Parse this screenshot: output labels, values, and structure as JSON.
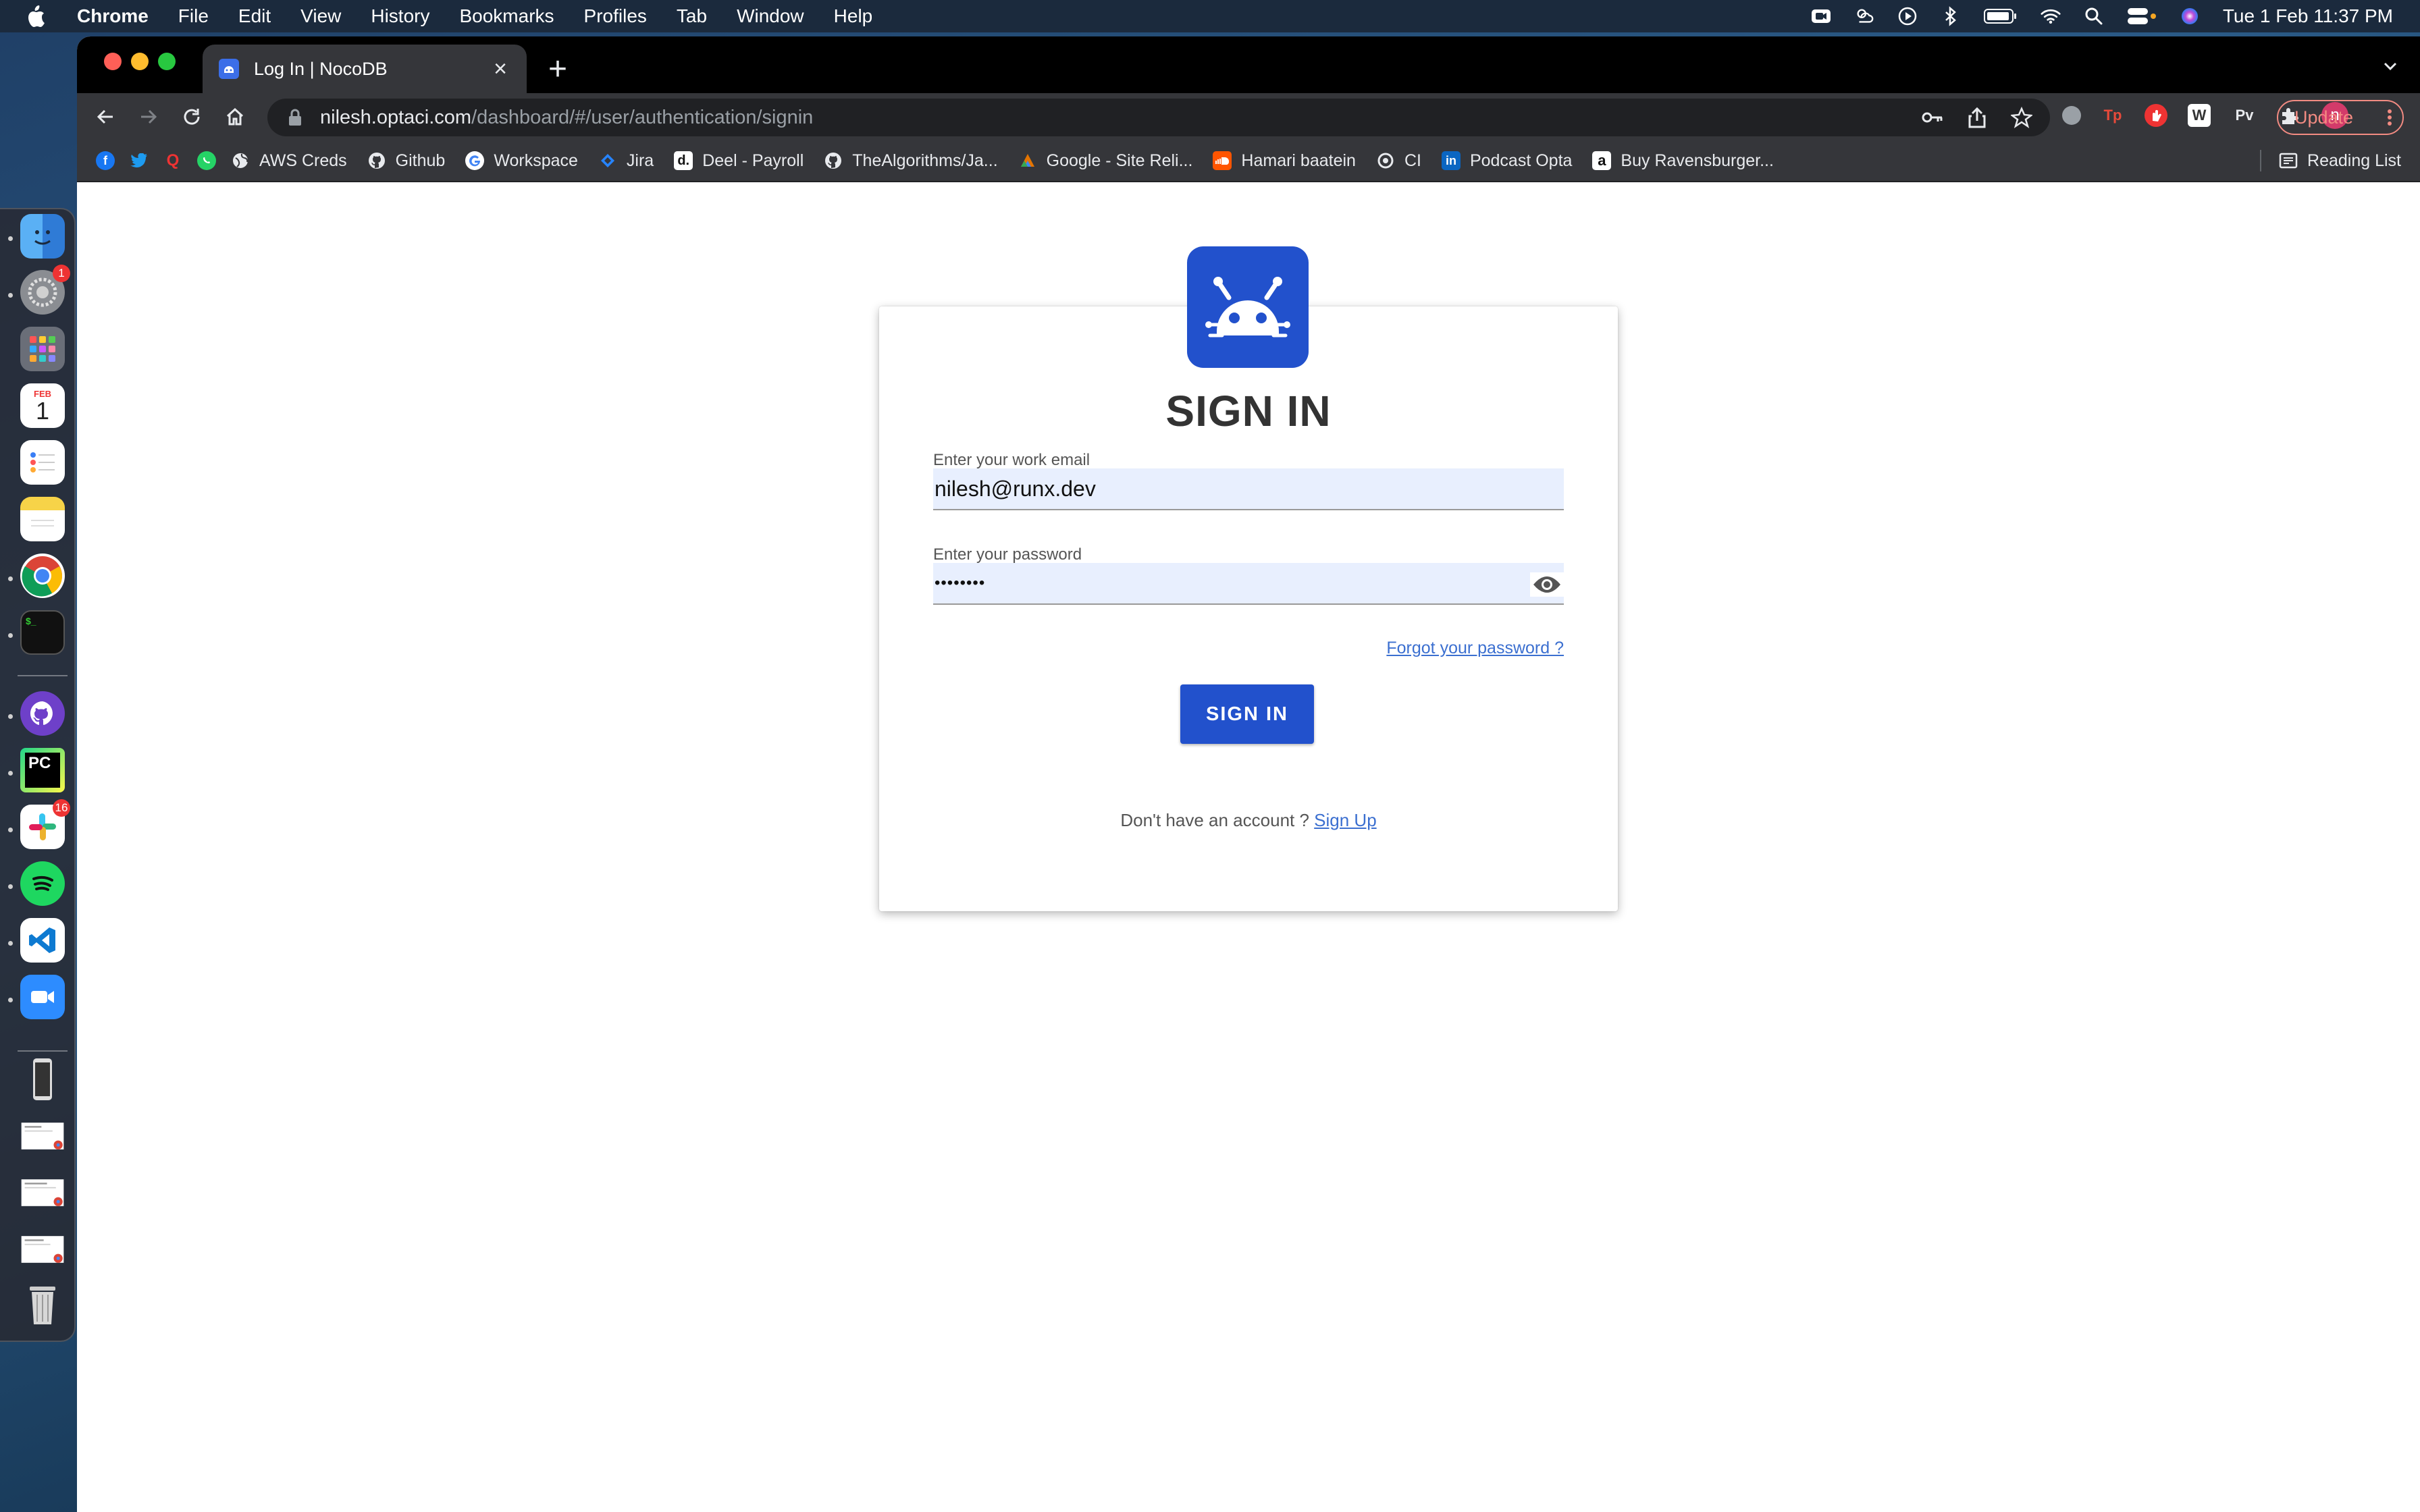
{
  "menubar": {
    "app_name": "Chrome",
    "items": [
      "File",
      "Edit",
      "View",
      "History",
      "Bookmarks",
      "Profiles",
      "Tab",
      "Window",
      "Help"
    ],
    "clock": "Tue 1 Feb  11:37 PM"
  },
  "dock": {
    "calendar_month": "FEB",
    "calendar_day": "1",
    "settings_badge": "1",
    "slack_badge": "16",
    "pycharm_label": "PC"
  },
  "browser": {
    "tab_title": "Log In | NocoDB",
    "url_host": "nilesh.optaci.com",
    "url_path": "/dashboard/#/user/authentication/signin",
    "update_label": "Update",
    "profile_initial": "n",
    "extensions": [
      "Tp",
      "W",
      "Pv"
    ],
    "bookmarks": [
      {
        "label": "AWS Creds",
        "icon": "globe-icon",
        "color": "#e8eaed"
      },
      {
        "label": "Github",
        "icon": "github-icon",
        "color": "#e8eaed"
      },
      {
        "label": "Workspace",
        "icon": "google-icon",
        "color": "#ffffff"
      },
      {
        "label": "Jira",
        "icon": "jira-icon",
        "color": "#2684ff"
      },
      {
        "label": "Deel - Payroll",
        "icon": "deel-icon",
        "color": "#ffffff"
      },
      {
        "label": "TheAlgorithms/Ja...",
        "icon": "github-icon",
        "color": "#e8eaed"
      },
      {
        "label": "Google - Site Reli...",
        "icon": "google-site-icon",
        "color": "#e37400"
      },
      {
        "label": "Hamari baatein",
        "icon": "soundcloud-icon",
        "color": "#ff5500"
      },
      {
        "label": "CI",
        "icon": "ci-icon",
        "color": "#e8eaed"
      },
      {
        "label": "Podcast Opta",
        "icon": "linkedin-icon",
        "color": "#0a66c2"
      },
      {
        "label": "Buy Ravensburger...",
        "icon": "amazon-icon",
        "color": "#ffffff"
      }
    ],
    "reading_list": "Reading List"
  },
  "signin": {
    "title": "SIGN IN",
    "email_label": "Enter your work email",
    "email_value": "nilesh@runx.dev",
    "password_label": "Enter your password",
    "password_value": "••••••••",
    "forgot_link": "Forgot your password ?",
    "submit_label": "SIGN IN",
    "no_account_text": "Don't have an account ?",
    "signup_link": "Sign Up"
  },
  "colors": {
    "brand_blue": "#2251cc",
    "link_blue": "#3b6fd0",
    "input_fill": "#e8effe"
  }
}
